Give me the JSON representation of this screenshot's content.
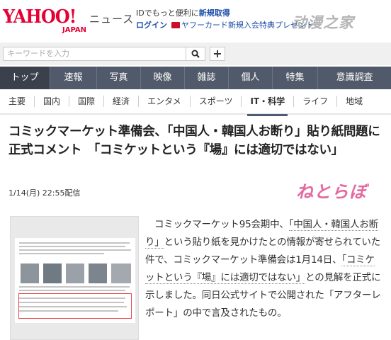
{
  "header": {
    "logo_main": "YAHOO!",
    "logo_sub": "JAPAN",
    "section_title": "ニュース",
    "id_prompt": "IDでもっと便利に",
    "register_link": "新規取得",
    "login_link": "ログイン",
    "promo_text": "ヤフーカード新規入会特典プレゼント",
    "watermark": "动漫之家"
  },
  "search": {
    "placeholder": "キーワードを入力",
    "search_icon": "search-icon",
    "plus_label": "+"
  },
  "main_nav": {
    "items": [
      "トップ",
      "速報",
      "写真",
      "映像",
      "雑誌",
      "個人",
      "特集",
      "意識調査"
    ],
    "active_index": 0
  },
  "sub_nav": {
    "items": [
      "主要",
      "国内",
      "国際",
      "経済",
      "エンタメ",
      "スポーツ",
      "IT・科学",
      "ライフ",
      "地域"
    ],
    "active_index": 6
  },
  "article": {
    "headline": "コミックマーケット準備会、「中国人・韓国人お断り」貼り紙問題に正式コメント　「コミケットという『場』には適切ではない」",
    "date": "1/14(月) 22:55配信",
    "source_logo": "ねとらぼ",
    "body_1": "コミックマーケット95会期中、",
    "body_2": "「中国人・韓国人お断り」",
    "body_3": "という貼り紙を見かけたとの情報が寄せられていた件で、コミックマーケット準備会は1月14日、",
    "body_4": "「コミケットという『場』には適切ではない」",
    "body_5": "との見解を正式に示しました。同日公式サイトで公開された「アフターレポート」の中で言及されたもの。"
  },
  "colors": {
    "brand_red": "#e60033",
    "nav_bg": "#515a6a",
    "link_blue": "#1d4fa7",
    "source_pink": "#e36aa0"
  }
}
